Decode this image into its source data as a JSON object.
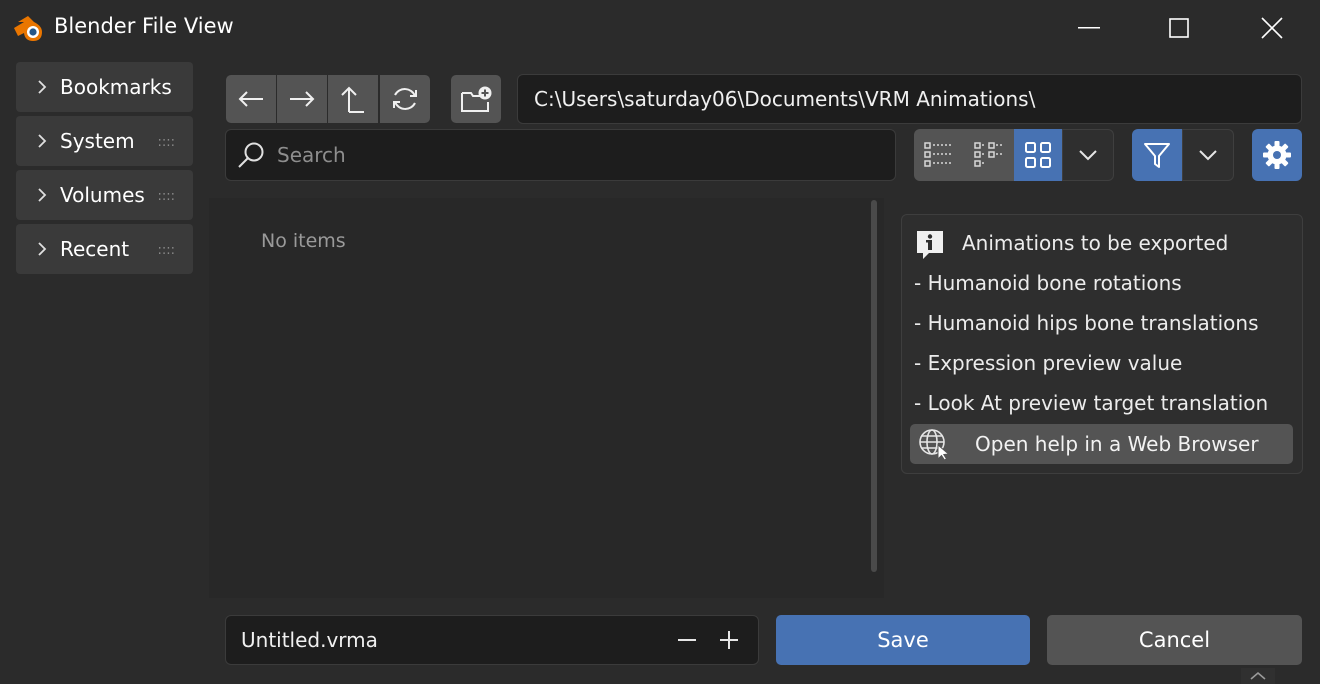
{
  "window": {
    "title": "Blender File View"
  },
  "sidebar": {
    "items": [
      {
        "label": "Bookmarks",
        "grip": ""
      },
      {
        "label": "System",
        "grip": "::::"
      },
      {
        "label": "Volumes",
        "grip": "::::"
      },
      {
        "label": "Recent",
        "grip": "::::"
      }
    ]
  },
  "toolbar": {
    "path": "C:\\Users\\saturday06\\Documents\\VRM Animations\\",
    "search_placeholder": "Search",
    "display_mode_selected": "thumbnails",
    "filter_active": true
  },
  "file_list": {
    "empty_text": "No items"
  },
  "info_panel": {
    "heading": "Animations to be exported",
    "lines": [
      "-  Humanoid bone rotations",
      "-  Humanoid hips bone translations",
      "-  Expression preview value",
      "-  Look At preview target translation"
    ],
    "help_button_label": "Open help in a Web Browser"
  },
  "footer": {
    "filename": "Untitled.vrma",
    "save_label": "Save",
    "cancel_label": "Cancel"
  },
  "colors": {
    "accent": "#4772b3",
    "background": "#2b2b2b",
    "field": "#1d1d1d",
    "button": "#545454"
  },
  "icons": [
    "blender-logo-icon",
    "minimize-icon",
    "maximize-icon",
    "close-icon",
    "chevron-right-icon",
    "arrow-left-icon",
    "arrow-right-icon",
    "parent-directory-icon",
    "refresh-icon",
    "new-folder-icon",
    "search-icon",
    "list-vertical-icon",
    "list-horizontal-icon",
    "thumbnails-icon",
    "chevron-down-icon",
    "filter-icon",
    "gear-icon",
    "info-icon",
    "globe-icon",
    "minus-icon",
    "plus-icon"
  ]
}
